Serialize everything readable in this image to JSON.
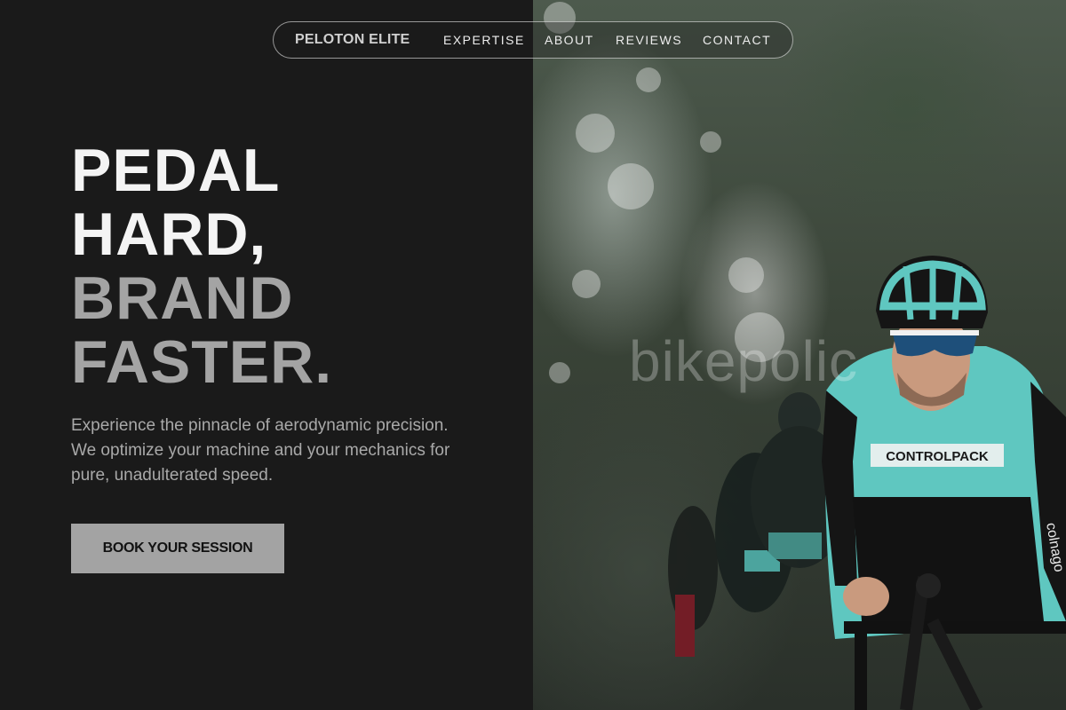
{
  "nav": {
    "brand": "PELOTON ELITE",
    "links": [
      "EXPERTISE",
      "ABOUT",
      "REVIEWS",
      "CONTACT"
    ]
  },
  "hero": {
    "headline_lines": [
      "PEDAL",
      "HARD,",
      "BRAND",
      "FASTER."
    ],
    "subtitle": "Experience the pinnacle of aerodynamic precision. We optimize your machine and your mechanics for pure, unadulterated speed.",
    "cta_label": "BOOK YOUR SESSION",
    "image": {
      "watermark": "bikepolic",
      "jersey_text": "CONTROLPACK",
      "sleeve_text": "colnago"
    }
  },
  "colors": {
    "background": "#1a1a1a",
    "headline_light": "#f4f4f4",
    "headline_muted": "#a4a4a4",
    "subtitle": "#a9a9a9",
    "cta_background": "#a3a3a3",
    "jersey_teal": "#5fc7c0"
  }
}
